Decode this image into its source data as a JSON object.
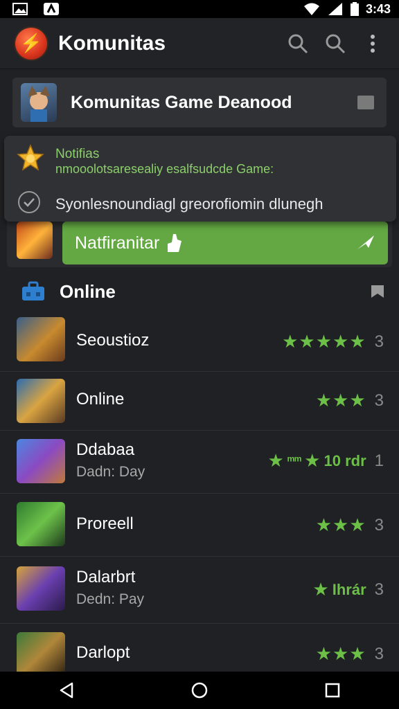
{
  "status_bar": {
    "time": "3:43"
  },
  "app_bar": {
    "title": "Komunitas"
  },
  "banner": {
    "title": "Komunitas Game Deanood"
  },
  "notification": {
    "title": "Notifias",
    "text": "nmooolotsaresealiy esalfsudcde Game:",
    "subtext": "Syonlesnoundiagl greorofiomin dlunegh"
  },
  "action": {
    "label": "Natfiranitar"
  },
  "section": {
    "title": "Online"
  },
  "games": [
    {
      "title": "Seoustioz",
      "subtitle": "",
      "stars": 5,
      "rating_text": "",
      "count": "3"
    },
    {
      "title": "Online",
      "subtitle": "",
      "stars": 3,
      "rating_text": "",
      "count": "3"
    },
    {
      "title": "Ddabaa",
      "subtitle": "Dadn: Day",
      "stars": 2,
      "rating_text": "10 rdr",
      "count": "1"
    },
    {
      "title": "Proreell",
      "subtitle": "",
      "stars": 3,
      "rating_text": "",
      "count": "3"
    },
    {
      "title": "Dalarbrt",
      "subtitle": "Dedn: Pay",
      "stars": 1,
      "rating_text": "Ihrár",
      "count": "3"
    },
    {
      "title": "Darlopt",
      "subtitle": "",
      "stars": 3,
      "rating_text": "",
      "count": "3"
    }
  ],
  "colors": {
    "accent_green": "#63a843",
    "background": "#202124",
    "card": "#303134"
  }
}
